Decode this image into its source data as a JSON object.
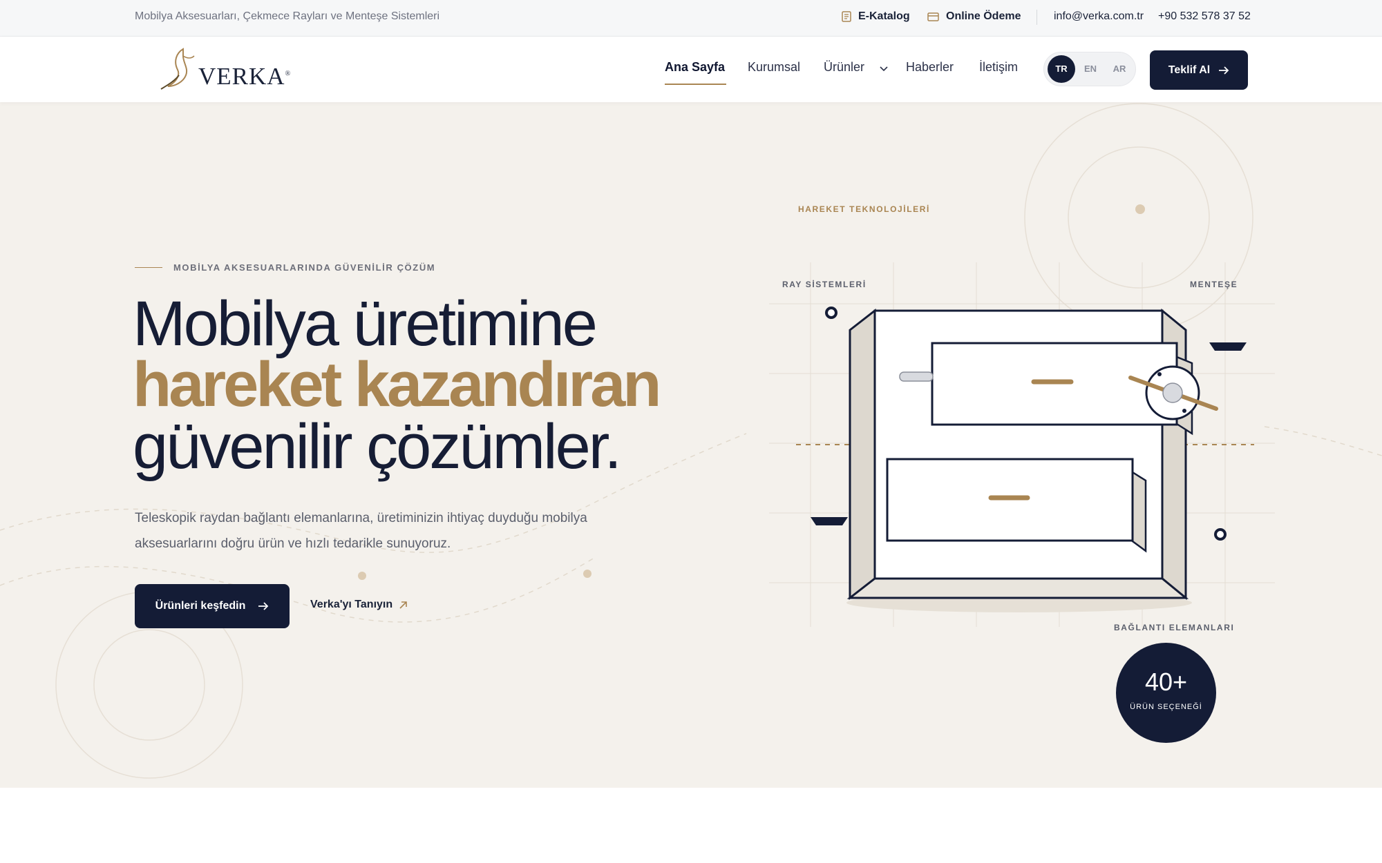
{
  "topbar": {
    "tagline": "Mobilya Aksesuarları, Çekmece Rayları ve Menteşe Sistemleri",
    "catalog": "E-Katalog",
    "payment": "Online Ödeme",
    "email": "info@verka.com.tr",
    "phone": "+90 532 578 37 52"
  },
  "header": {
    "logo_text": "VERKA",
    "logo_mark": "®",
    "nav": [
      "Ana Sayfa",
      "Kurumsal",
      "Ürünler",
      "Haberler",
      "İletişim"
    ],
    "active_nav": "Ana Sayfa",
    "languages": [
      "TR",
      "EN",
      "AR"
    ],
    "active_language": "TR",
    "cta_label": "Teklif Al"
  },
  "hero": {
    "eyebrow": "MOBİLYA AKSESUARLARINDA GÜVENİLİR ÇÖZÜM",
    "title_line1": "Mobilya üretimine",
    "title_line2": "hareket kazandıran",
    "title_line3": "güvenilir çözümler.",
    "lead": "Teleskopik raydan bağlantı elemanlarına, üretiminizin ihtiyaç duyduğu mobilya aksesuarlarını doğru ürün ve hızlı tedarikle sunuyoruz.",
    "primary_button": "Ürünleri keşfedin",
    "secondary_link": "Verka'yı Tanıyın"
  },
  "illustration": {
    "heading": "HAREKET TEKNOLOJİLERİ",
    "label_rails": "RAY SİSTEMLERİ",
    "label_hinge": "MENTEŞE",
    "label_connectors": "BAĞLANTI ELEMANLARI"
  },
  "stat": {
    "value": "40+",
    "label": "ÜRÜN SEÇENEĞİ"
  },
  "colors": {
    "navy": "#141c36",
    "gold": "#a98552",
    "hero_bg": "#f4f1ec"
  }
}
